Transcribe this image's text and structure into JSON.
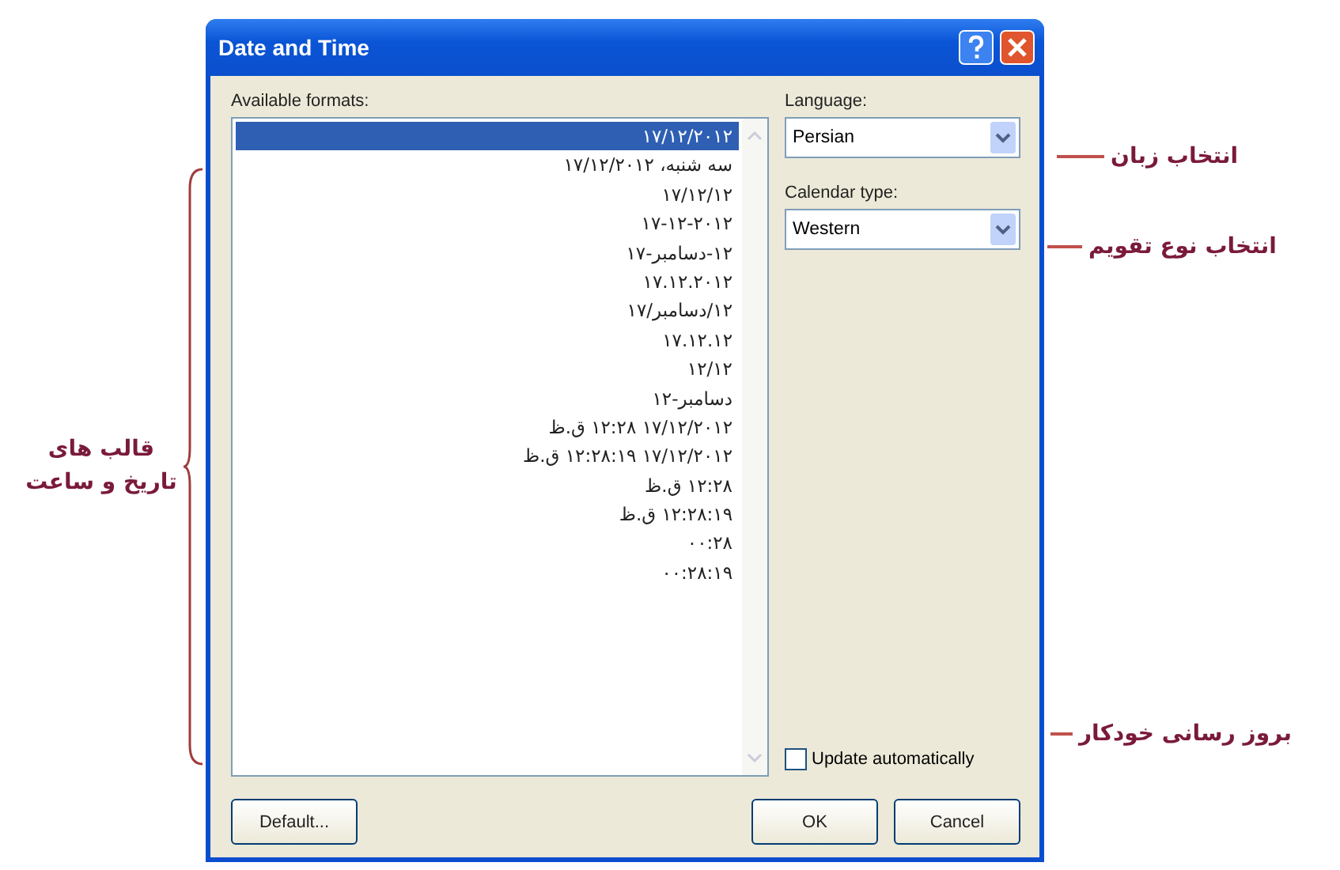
{
  "window": {
    "title": "Date and Time"
  },
  "formats": {
    "label": "Available formats:",
    "items": [
      {
        "text": "۱۷/۱۲/۲۰۱۲",
        "selected": true
      },
      {
        "text": "سه شنبه، ۱۷/۱۲/۲۰۱۲",
        "selected": false
      },
      {
        "text": "۱۷/۱۲/۱۲",
        "selected": false
      },
      {
        "text": "۱۷-۱۲-۲۰۱۲",
        "selected": false
      },
      {
        "text": "۱۲-دسامبر-۱۷",
        "selected": false
      },
      {
        "text": "۱۷.۱۲.۲۰۱۲",
        "selected": false
      },
      {
        "text": "۱۲/دسامبر/۱۷",
        "selected": false
      },
      {
        "text": "۱۷.۱۲.۱۲",
        "selected": false
      },
      {
        "text": "۱۲/۱۲",
        "selected": false
      },
      {
        "text": "دسامبر-۱۲",
        "selected": false
      },
      {
        "text": "۱۷/۱۲/۲۰۱۲ ۱۲:۲۸ ق.ظ",
        "selected": false
      },
      {
        "text": "۱۷/۱۲/۲۰۱۲ ۱۲:۲۸:۱۹ ق.ظ",
        "selected": false
      },
      {
        "text": "۱۲:۲۸ ق.ظ",
        "selected": false
      },
      {
        "text": "۱۲:۲۸:۱۹ ق.ظ",
        "selected": false
      },
      {
        "text": "۰۰:۲۸",
        "selected": false
      },
      {
        "text": "۰۰:۲۸:۱۹",
        "selected": false
      }
    ]
  },
  "language": {
    "label": "Language:",
    "value": "Persian"
  },
  "calendar_type": {
    "label": "Calendar type:",
    "value": "Western"
  },
  "update_automatically": {
    "label": "Update automatically",
    "checked": false
  },
  "buttons": {
    "default": "Default...",
    "ok": "OK",
    "cancel": "Cancel"
  },
  "callouts": {
    "formats": "قالب های تاریخ و ساعت",
    "language": "انتخاب زبان",
    "calendar_type": "انتخاب نوع تقویم",
    "update_automatically": "بروز رسانی خودکار"
  }
}
